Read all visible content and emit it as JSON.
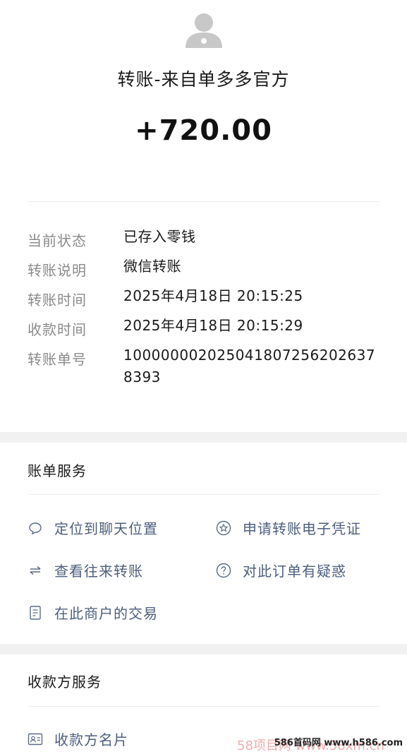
{
  "header": {
    "payer_title": "转账-来自单多多官方",
    "amount": "+720.00"
  },
  "details": [
    {
      "label": "当前状态",
      "value": "已存入零钱"
    },
    {
      "label": "转账说明",
      "value": "微信转账"
    },
    {
      "label": "转账时间",
      "value": "2025年4月18日 20:15:25"
    },
    {
      "label": "收款时间",
      "value": "2025年4月18日 20:15:29"
    },
    {
      "label": "转账单号",
      "value": "100000002025041807256202637 8393"
    }
  ],
  "bill_services": {
    "title": "账单服务",
    "items": [
      {
        "label": "定位到聊天位置",
        "icon": "chat-bubble-icon"
      },
      {
        "label": "申请转账电子凭证",
        "icon": "star-badge-icon"
      },
      {
        "label": "查看往来转账",
        "icon": "transfer-arrows-icon"
      },
      {
        "label": "对此订单有疑惑",
        "icon": "question-icon"
      },
      {
        "label": "在此商户的交易",
        "icon": "document-icon"
      }
    ]
  },
  "payee_services": {
    "title": "收款方服务",
    "items": [
      {
        "label": "收款方名片",
        "icon": "contact-card-icon"
      }
    ]
  },
  "watermark": {
    "text": "586首码网 www.h586.com",
    "faded": "58项目网 www.58xm.cn"
  },
  "colors": {
    "link_text": "#4d5e7d",
    "label_text": "#8a8a8a",
    "section_gap": "#f1f1f1"
  }
}
